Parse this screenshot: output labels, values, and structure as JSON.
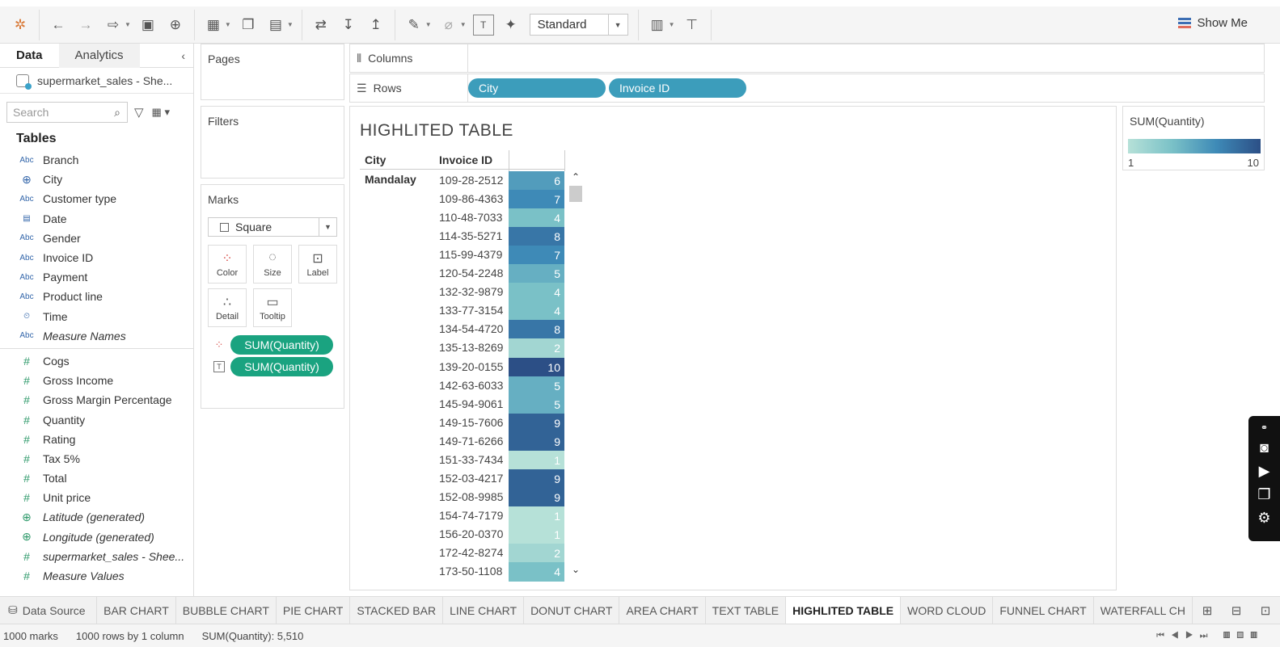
{
  "toolbar": {
    "standard_label": "Standard",
    "show_me_label": "Show Me"
  },
  "left_pane": {
    "tab_data": "Data",
    "tab_analytics": "Analytics",
    "datasource": "supermarket_sales - She...",
    "search_placeholder": "Search",
    "tables_title": "Tables",
    "dimensions": [
      {
        "type": "Abc",
        "name": "Branch"
      },
      {
        "type": "globe",
        "name": "City"
      },
      {
        "type": "Abc",
        "name": "Customer type"
      },
      {
        "type": "date",
        "name": "Date"
      },
      {
        "type": "Abc",
        "name": "Gender"
      },
      {
        "type": "Abc",
        "name": "Invoice ID"
      },
      {
        "type": "Abc",
        "name": "Payment"
      },
      {
        "type": "Abc",
        "name": "Product line"
      },
      {
        "type": "time",
        "name": "Time"
      },
      {
        "type": "Abc",
        "name": "Measure Names",
        "italic": true
      }
    ],
    "measures": [
      {
        "type": "#",
        "name": "Cogs"
      },
      {
        "type": "#",
        "name": "Gross Income"
      },
      {
        "type": "#",
        "name": "Gross Margin Percentage"
      },
      {
        "type": "#",
        "name": "Quantity"
      },
      {
        "type": "#",
        "name": "Rating"
      },
      {
        "type": "#",
        "name": "Tax 5%"
      },
      {
        "type": "#",
        "name": "Total"
      },
      {
        "type": "#",
        "name": "Unit price"
      },
      {
        "type": "globe",
        "name": "Latitude (generated)",
        "italic": true
      },
      {
        "type": "globe",
        "name": "Longitude (generated)",
        "italic": true
      },
      {
        "type": "#",
        "name": "supermarket_sales - Shee...",
        "italic": true
      },
      {
        "type": "#",
        "name": "Measure Values",
        "italic": true
      }
    ]
  },
  "cards": {
    "pages": "Pages",
    "filters": "Filters",
    "marks": "Marks",
    "mark_type": "Square",
    "mark_buttons": [
      "Color",
      "Size",
      "Label",
      "Detail",
      "Tooltip"
    ],
    "mark_pills": [
      "SUM(Quantity)",
      "SUM(Quantity)"
    ]
  },
  "shelves": {
    "columns_label": "Columns",
    "rows_label": "Rows",
    "row_pills": [
      "City",
      "Invoice ID"
    ]
  },
  "viz": {
    "title": "HIGHLITED TABLE",
    "col_city": "City",
    "col_invoice": "Invoice ID",
    "city": "Mandalay"
  },
  "chart_data": {
    "type": "table",
    "title": "HIGHLITED TABLE",
    "columns": [
      "City",
      "Invoice ID",
      "SUM(Quantity)"
    ],
    "city": "Mandalay",
    "rows": [
      {
        "id": "109-28-2512",
        "value": 6
      },
      {
        "id": "109-86-4363",
        "value": 7
      },
      {
        "id": "110-48-7033",
        "value": 4
      },
      {
        "id": "114-35-5271",
        "value": 8
      },
      {
        "id": "115-99-4379",
        "value": 7
      },
      {
        "id": "120-54-2248",
        "value": 5
      },
      {
        "id": "132-32-9879",
        "value": 4
      },
      {
        "id": "133-77-3154",
        "value": 4
      },
      {
        "id": "134-54-4720",
        "value": 8
      },
      {
        "id": "135-13-8269",
        "value": 2
      },
      {
        "id": "139-20-0155",
        "value": 10
      },
      {
        "id": "142-63-6033",
        "value": 5
      },
      {
        "id": "145-94-9061",
        "value": 5
      },
      {
        "id": "149-15-7606",
        "value": 9
      },
      {
        "id": "149-71-6266",
        "value": 9
      },
      {
        "id": "151-33-7434",
        "value": 1
      },
      {
        "id": "152-03-4217",
        "value": 9
      },
      {
        "id": "152-08-9985",
        "value": 9
      },
      {
        "id": "154-74-7179",
        "value": 1
      },
      {
        "id": "156-20-0370",
        "value": 1
      },
      {
        "id": "172-42-8274",
        "value": 2
      },
      {
        "id": "173-50-1108",
        "value": 4
      }
    ],
    "color_range": [
      1,
      10
    ],
    "colors": {
      "low": "#b6e1d8",
      "high": "#2c4f86"
    }
  },
  "legend": {
    "title": "SUM(Quantity)",
    "min": "1",
    "max": "10"
  },
  "sheet_tabs": {
    "data_source": "Data Source",
    "tabs": [
      "BAR CHART",
      "BUBBLE CHART",
      "PIE CHART",
      "STACKED BAR",
      "LINE CHART",
      "DONUT CHART",
      "AREA CHART",
      "TEXT TABLE",
      "HIGHLITED TABLE",
      "WORD CLOUD",
      "FUNNEL CHART",
      "WATERFALL CH"
    ],
    "active": "HIGHLITED TABLE"
  },
  "status": {
    "marks": "1000 marks",
    "rows": "1000 rows by 1 column",
    "sum": "SUM(Quantity): 5,510"
  }
}
